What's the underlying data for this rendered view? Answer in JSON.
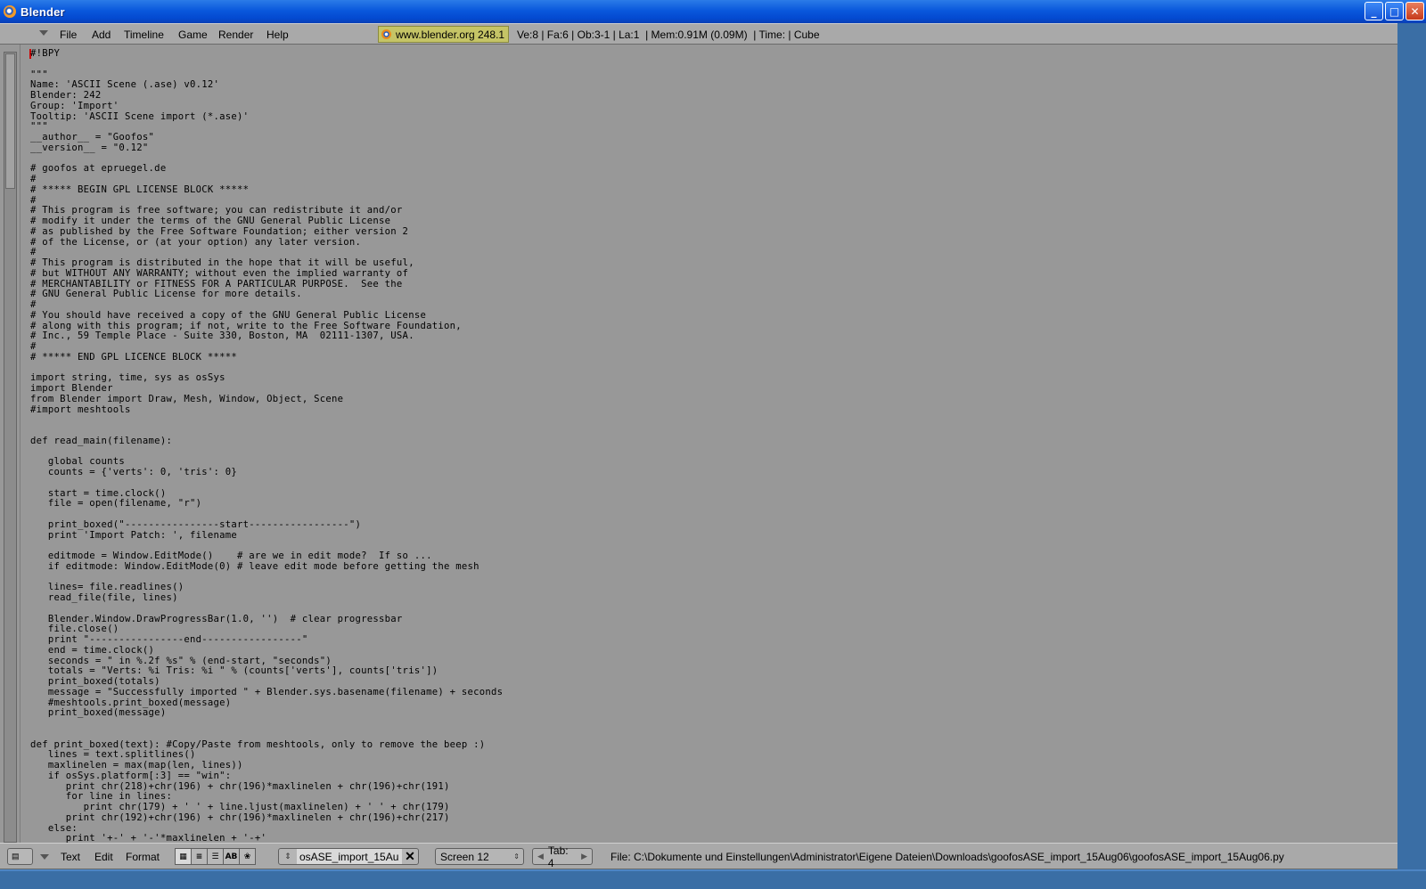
{
  "window": {
    "title": "Blender",
    "buttons": {
      "minimize": "_",
      "maximize": "□",
      "close": "✕"
    }
  },
  "header": {
    "menus": [
      "File",
      "Add",
      "Timeline",
      "Game",
      "Render",
      "Help"
    ],
    "info_url": "www.blender.org 248.1",
    "info_stats": "Ve:8 | Fa:6 | Ob:3-1 | La:1  | Mem:0.91M (0.09M)  | Time: | Cube"
  },
  "editor": {
    "lines": [
      "#!BPY",
      "",
      "\"\"\"",
      "Name: 'ASCII Scene (.ase) v0.12'",
      "Blender: 242",
      "Group: 'Import'",
      "Tooltip: 'ASCII Scene import (*.ase)'",
      "\"\"\"",
      "__author__ = \"Goofos\"",
      "__version__ = \"0.12\"",
      "",
      "# goofos at epruegel.de",
      "#",
      "# ***** BEGIN GPL LICENSE BLOCK *****",
      "#",
      "# This program is free software; you can redistribute it and/or",
      "# modify it under the terms of the GNU General Public License",
      "# as published by the Free Software Foundation; either version 2",
      "# of the License, or (at your option) any later version.",
      "#",
      "# This program is distributed in the hope that it will be useful,",
      "# but WITHOUT ANY WARRANTY; without even the implied warranty of",
      "# MERCHANTABILITY or FITNESS FOR A PARTICULAR PURPOSE.  See the",
      "# GNU General Public License for more details.",
      "#",
      "# You should have received a copy of the GNU General Public License",
      "# along with this program; if not, write to the Free Software Foundation,",
      "# Inc., 59 Temple Place - Suite 330, Boston, MA  02111-1307, USA.",
      "#",
      "# ***** END GPL LICENCE BLOCK *****",
      "",
      "import string, time, sys as osSys",
      "import Blender",
      "from Blender import Draw, Mesh, Window, Object, Scene",
      "#import meshtools",
      "",
      "",
      "def read_main(filename):",
      "",
      "   global counts",
      "   counts = {'verts': 0, 'tris': 0}",
      "",
      "   start = time.clock()",
      "   file = open(filename, \"r\")",
      "",
      "   print_boxed(\"----------------start-----------------\")",
      "   print 'Import Patch: ', filename",
      "",
      "   editmode = Window.EditMode()    # are we in edit mode?  If so ...",
      "   if editmode: Window.EditMode(0) # leave edit mode before getting the mesh",
      "",
      "   lines= file.readlines()",
      "   read_file(file, lines)",
      "",
      "   Blender.Window.DrawProgressBar(1.0, '')  # clear progressbar",
      "   file.close()",
      "   print \"----------------end-----------------\"",
      "   end = time.clock()",
      "   seconds = \" in %.2f %s\" % (end-start, \"seconds\")",
      "   totals = \"Verts: %i Tris: %i \" % (counts['verts'], counts['tris'])",
      "   print_boxed(totals)",
      "   message = \"Successfully imported \" + Blender.sys.basename(filename) + seconds",
      "   #meshtools.print_boxed(message)",
      "   print_boxed(message)",
      "",
      "",
      "def print_boxed(text): #Copy/Paste from meshtools, only to remove the beep :)",
      "   lines = text.splitlines()",
      "   maxlinelen = max(map(len, lines))",
      "   if osSys.platform[:3] == \"win\":",
      "      print chr(218)+chr(196) + chr(196)*maxlinelen + chr(196)+chr(191)",
      "      for line in lines:",
      "         print chr(179) + ' ' + line.ljust(maxlinelen) + ' ' + chr(179)",
      "      print chr(192)+chr(196) + chr(196)*maxlinelen + chr(196)+chr(217)",
      "   else:",
      "      print '+-' + '-'*maxlinelen + '-+'"
    ]
  },
  "bottombar": {
    "menus": [
      "Text",
      "Edit",
      "Format"
    ],
    "toggles": [
      "AB"
    ],
    "text_block_name": "osASE_import_15Au",
    "screen": "Screen 12",
    "tab": "Tab: 4",
    "file_path": "File: C:\\Dokumente und Einstellungen\\Administrator\\Eigene Dateien\\Downloads\\goofosASE_import_15Aug06\\goofosASE_import_15Aug06.py"
  }
}
